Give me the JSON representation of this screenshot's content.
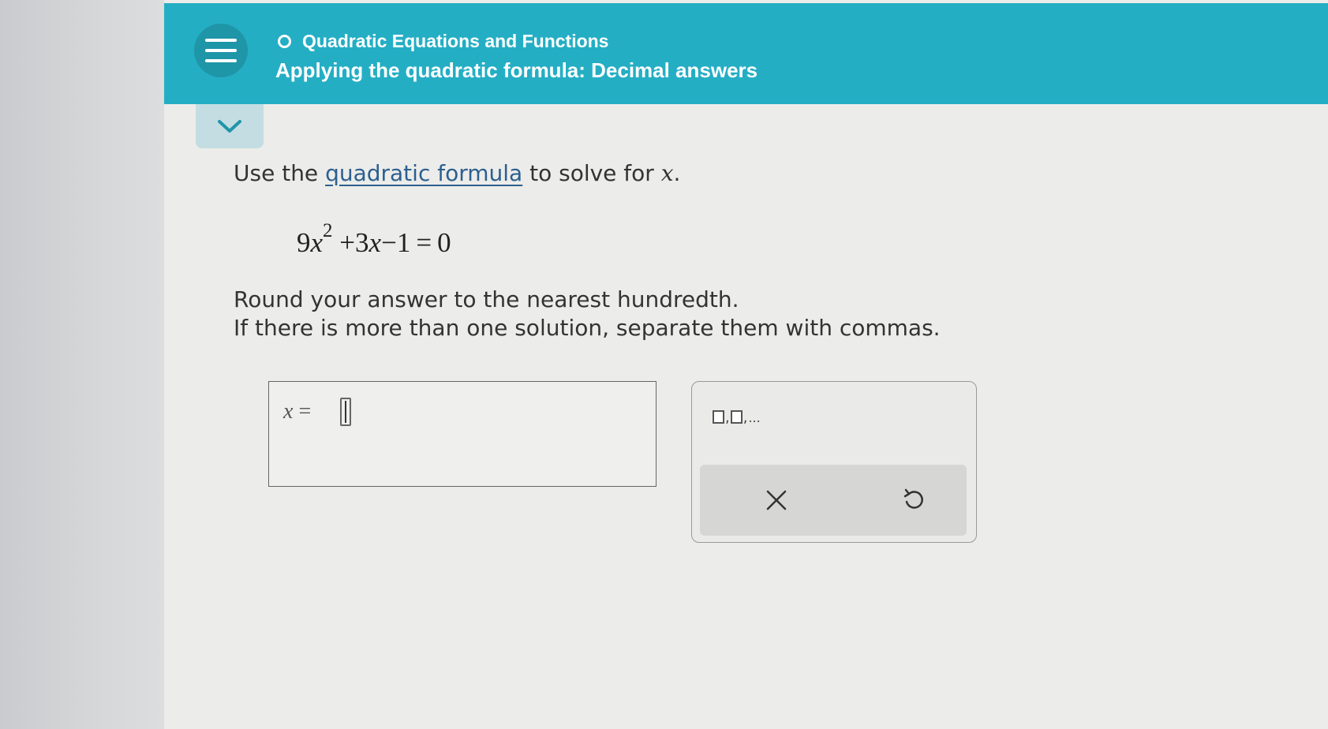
{
  "header": {
    "topic": "Quadratic Equations and Functions",
    "title": "Applying the quadratic formula: Decimal answers",
    "menu_icon": "hamburger-menu-icon",
    "topic_icon": "circle-icon",
    "collapse_icon": "chevron-down-icon"
  },
  "question": {
    "instruction_prefix": "Use the ",
    "instruction_link": "quadratic formula",
    "instruction_suffix": " to solve for ",
    "variable": "x",
    "period": ".",
    "equation": {
      "coef_a": "9",
      "var1": "x",
      "exponent": "2",
      "plus_term": " +3",
      "var2": "x",
      "rest": "−1 = 0"
    },
    "round_line_1": "Round your answer to the nearest hundredth.",
    "round_line_2": "If there is more than one solution, separate them with commas."
  },
  "answer": {
    "label_var": "x",
    "label_eq": " = ",
    "value": ""
  },
  "tools": {
    "list_comma_1": ",",
    "list_comma_2": ",",
    "list_dots": "...",
    "clear_icon": "close-icon",
    "undo_icon": "undo-icon"
  },
  "colors": {
    "header_bg": "#24aec4",
    "link": "#2c5f8f",
    "page_bg": "#ececea"
  }
}
